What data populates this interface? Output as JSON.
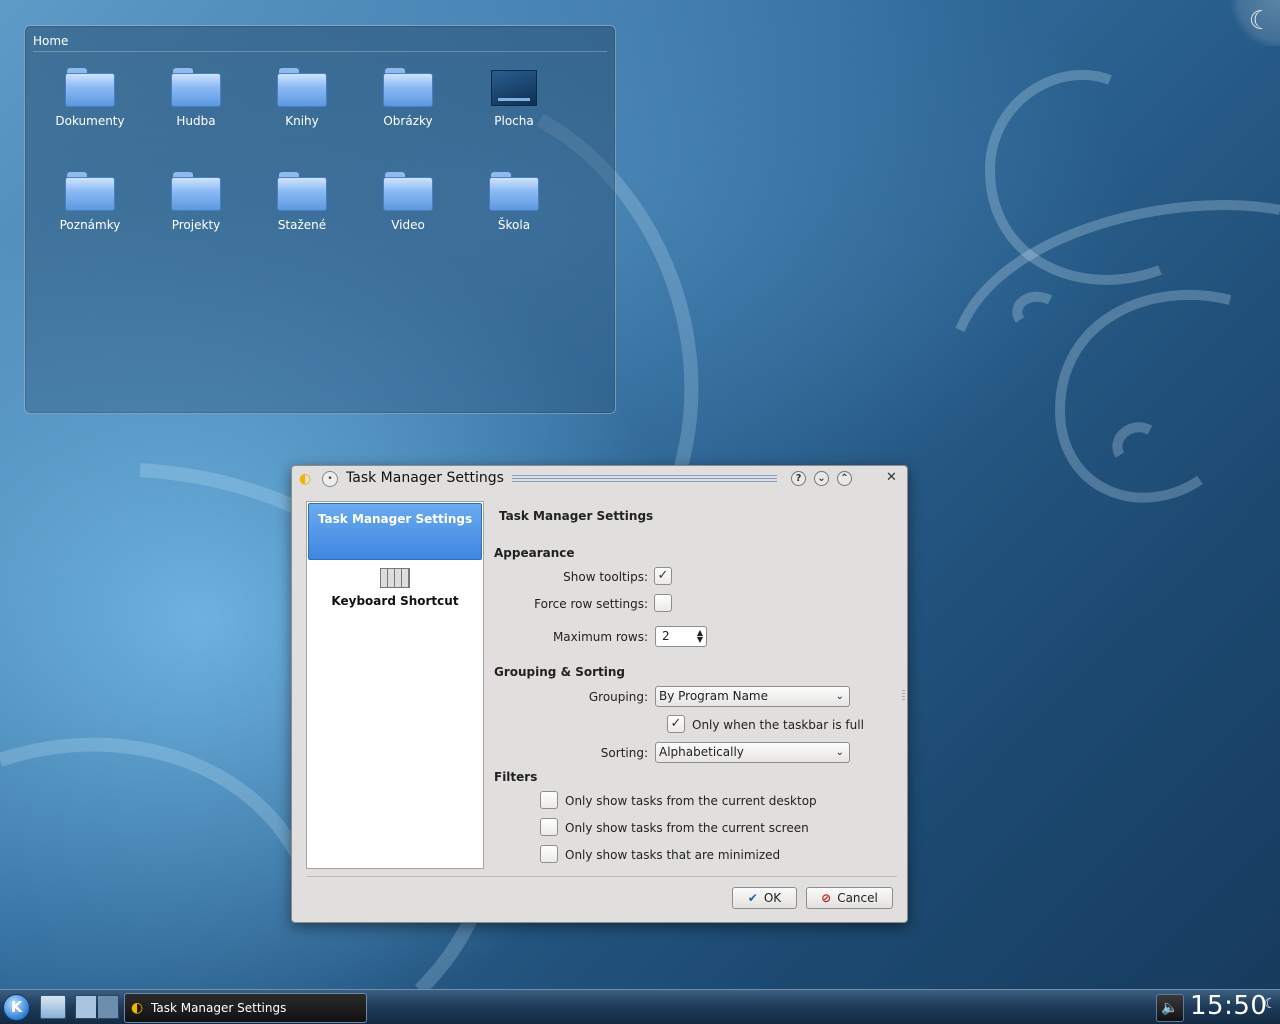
{
  "folderview": {
    "title": "Home",
    "items": [
      {
        "label": "Dokumenty",
        "icon": "folder-icon"
      },
      {
        "label": "Hudba",
        "icon": "folder-icon"
      },
      {
        "label": "Knihy",
        "icon": "folder-icon"
      },
      {
        "label": "Obrázky",
        "icon": "folder-icon"
      },
      {
        "label": "Plocha",
        "icon": "desktop-icon"
      },
      {
        "label": "Poznámky",
        "icon": "folder-icon"
      },
      {
        "label": "Projekty",
        "icon": "folder-icon"
      },
      {
        "label": "Stažené",
        "icon": "folder-icon"
      },
      {
        "label": "Video",
        "icon": "folder-icon"
      },
      {
        "label": "Škola",
        "icon": "folder-icon"
      }
    ]
  },
  "dialog": {
    "title": "Task Manager Settings",
    "titlebar_buttons": {
      "help": "?",
      "minimize": "⌄",
      "maximize": "⌃",
      "close": "✕"
    },
    "sidebar": {
      "items": [
        {
          "label": "Task Manager Settings",
          "selected": true
        },
        {
          "label": "Keyboard Shortcut",
          "selected": false,
          "icon": "keyboard-icon"
        }
      ]
    },
    "page_title": "Task Manager Settings",
    "appearance": {
      "heading": "Appearance",
      "show_tooltips_label": "Show tooltips:",
      "show_tooltips_checked": true,
      "force_row_label": "Force row settings:",
      "force_row_checked": false,
      "max_rows_label": "Maximum rows:",
      "max_rows_value": "2"
    },
    "grouping": {
      "heading": "Grouping & Sorting",
      "grouping_label": "Grouping:",
      "grouping_value": "By Program Name",
      "only_when_full_label": "Only when the taskbar is full",
      "only_when_full_checked": true,
      "sorting_label": "Sorting:",
      "sorting_value": "Alphabetically"
    },
    "filters": {
      "heading": "Filters",
      "options": [
        {
          "label": "Only show tasks from the current desktop",
          "checked": false
        },
        {
          "label": "Only show tasks from the current screen",
          "checked": false
        },
        {
          "label": "Only show tasks that are minimized",
          "checked": false
        }
      ]
    },
    "buttons": {
      "ok": "OK",
      "cancel": "Cancel"
    }
  },
  "panel": {
    "task_label": "Task Manager Settings",
    "clock": "15:50"
  },
  "colors": {
    "selection": "#3f87e0",
    "dialog_bg": "#e0dfdd",
    "panel_bg": "#1d3a58"
  }
}
